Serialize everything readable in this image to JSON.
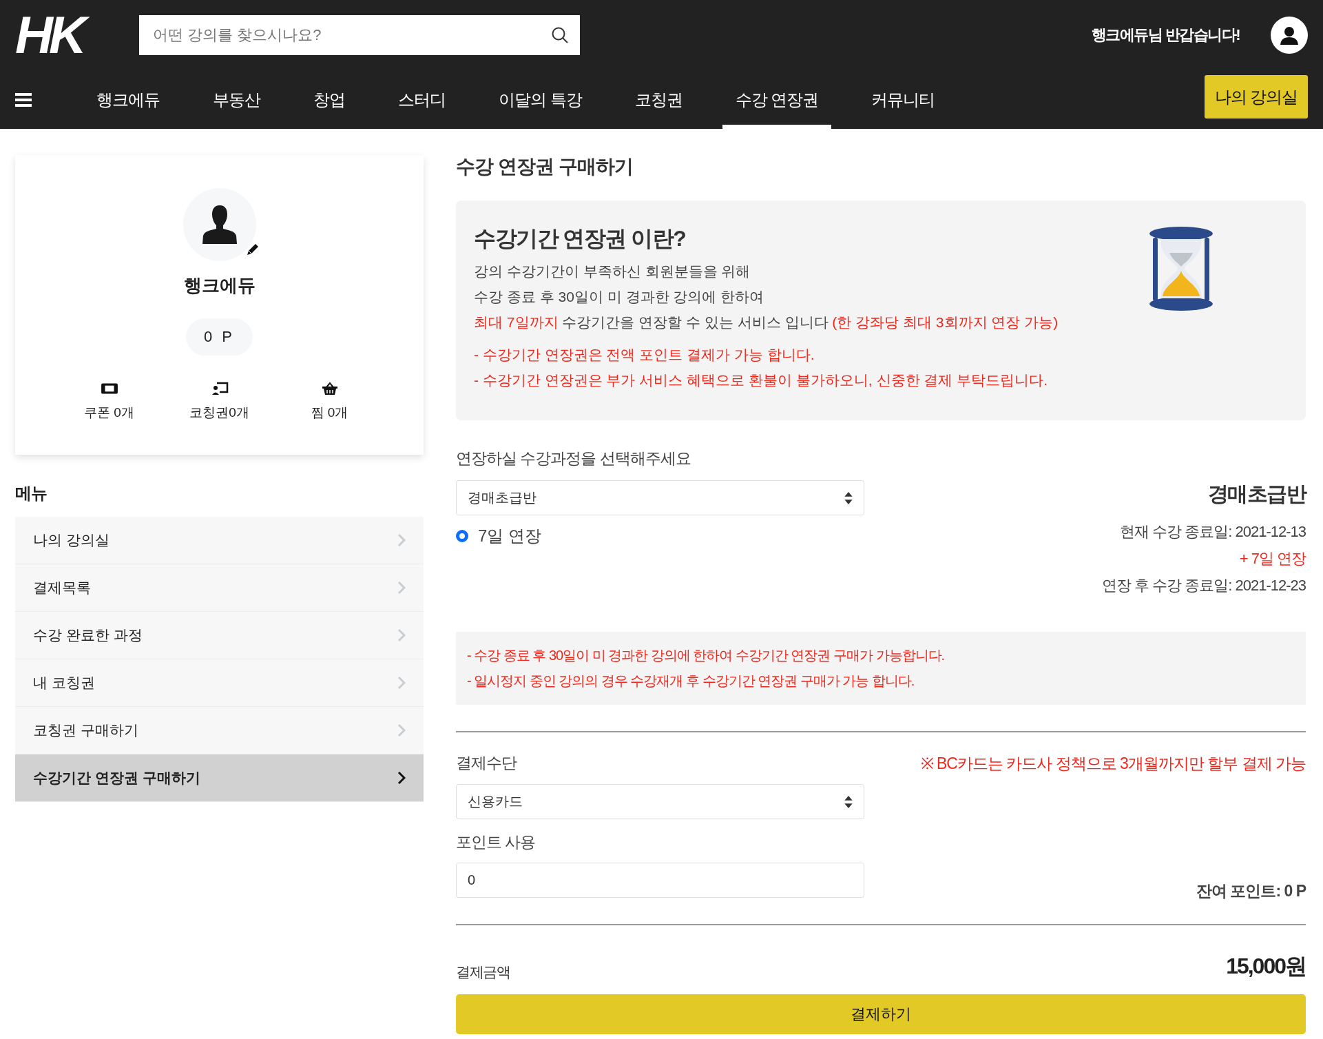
{
  "header": {
    "logo": "HK",
    "search": {
      "placeholder": "어떤 강의를 찾으시나요?"
    },
    "greeting": "행크에듀님 반갑습니다!",
    "nav": [
      {
        "label": "행크에듀",
        "selected": false
      },
      {
        "label": "부동산",
        "selected": false
      },
      {
        "label": "창업",
        "selected": false
      },
      {
        "label": "스터디",
        "selected": false
      },
      {
        "label": "이달의 특강",
        "selected": false
      },
      {
        "label": "코칭권",
        "selected": false
      },
      {
        "label": "수강 연장권",
        "selected": true
      },
      {
        "label": "커뮤니티",
        "selected": false
      }
    ],
    "my_classroom_button": "나의 강의실"
  },
  "profile": {
    "name": "행크에듀",
    "points": "0 P",
    "stats": [
      {
        "kind": "coupon",
        "label": "쿠폰 0개"
      },
      {
        "kind": "coaching",
        "label": "코칭권0개"
      },
      {
        "kind": "wishlist",
        "label": "찜 0개"
      }
    ]
  },
  "menu": {
    "title": "메뉴",
    "items": [
      {
        "label": "나의 강의실",
        "selected": false
      },
      {
        "label": "결제목록",
        "selected": false
      },
      {
        "label": "수강 완료한 과정",
        "selected": false
      },
      {
        "label": "내 코칭권",
        "selected": false
      },
      {
        "label": "코칭권 구매하기",
        "selected": false
      },
      {
        "label": "수강기간 연장권 구매하기",
        "selected": true
      }
    ]
  },
  "main": {
    "title": "수강 연장권 구매하기",
    "info": {
      "heading": "수강기간 연장권 이란?",
      "lines": [
        [
          {
            "text": "강의 수강기간이 부족하신 회원분들을 위해",
            "emphasis": false
          }
        ],
        [
          {
            "text": "수강 종료 후 30일이 미 경과한 강의에 한하여",
            "emphasis": false
          }
        ],
        [
          {
            "text": "최대 7일까지",
            "emphasis": true
          },
          {
            "text": " 수강기간을 연장할 수 있는 서비스 입니다 ",
            "emphasis": false
          },
          {
            "text": "(한 강좌당 최대 3회까지 연장 가능)",
            "emphasis": true
          }
        ]
      ],
      "notes": [
        "- 수강기간 연장권은 전액 포인트 결제가 가능 합니다.",
        "- 수강기간 연장권은 부가 서비스 혜택으로 환불이 불가하오니, 신중한 결제 부탁드립니다."
      ]
    },
    "course_select": {
      "label": "연장하실 수강과정을 선택해주세요",
      "value": "경매초급반"
    },
    "options": [
      {
        "label": "7일 연장",
        "selected": true
      }
    ],
    "summary": {
      "course": "경매초급반",
      "current_end": "현재 수강 종료일: 2021-12-13",
      "extension": "+ 7일 연장",
      "new_end": "연장 후 수강 종료일: 2021-12-23"
    },
    "notices": [
      "- 수강 종료 후 30일이 미 경과한 강의에 한하여 수강기간 연장권 구매가 가능합니다.",
      "- 일시정지 중인 강의의 경우 수강재개 후 수강기간 연장권 구매가 가능 합니다."
    ],
    "payment": {
      "label": "결제수단",
      "notice": "※ BC카드는 카드사 정책으로 3개월까지만 할부 결제 가능",
      "method": "신용카드"
    },
    "points": {
      "label": "포인트 사용",
      "value": "0",
      "remaining": "잔여 포인트: 0 P"
    },
    "total": {
      "label": "결제금액",
      "amount": "15,000원"
    },
    "pay_button": "결제하기"
  }
}
